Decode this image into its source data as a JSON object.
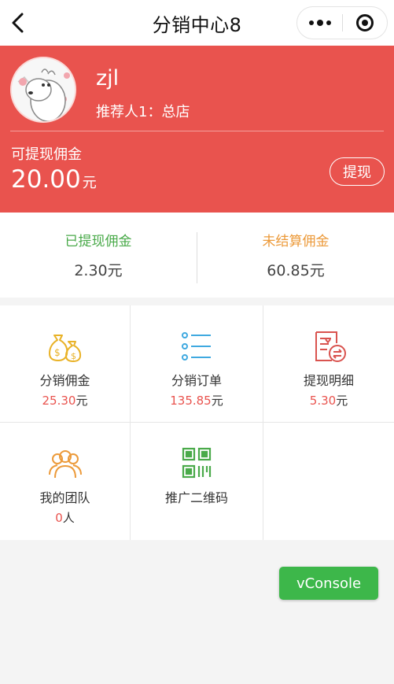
{
  "header": {
    "title": "分销中心8"
  },
  "profile": {
    "username": "zjl",
    "referrer": "推荐人1：总店"
  },
  "withdrawable": {
    "label": "可提现佣金",
    "amount": "20.00",
    "unit": "元",
    "button_label": "提现"
  },
  "stats": [
    {
      "label": "已提现佣金",
      "value": "2.30元",
      "color": "#4aaa4a"
    },
    {
      "label": "未结算佣金",
      "value": "60.85元",
      "color": "#ec9a3a"
    }
  ],
  "menu": [
    {
      "label": "分销佣金",
      "value": "25.30",
      "unit": "元",
      "icon": "money-bags-icon"
    },
    {
      "label": "分销订单",
      "value": "135.85",
      "unit": "元",
      "icon": "list-icon"
    },
    {
      "label": "提现明细",
      "value": "5.30",
      "unit": "元",
      "icon": "withdraw-detail-icon"
    },
    {
      "label": "我的团队",
      "value": "0",
      "unit": "人",
      "icon": "team-icon"
    },
    {
      "label": "推广二维码",
      "icon": "qrcode-icon"
    }
  ],
  "vconsole": {
    "label": "vConsole"
  },
  "colors": {
    "accent": "#e9534e",
    "green": "#3db74a"
  }
}
